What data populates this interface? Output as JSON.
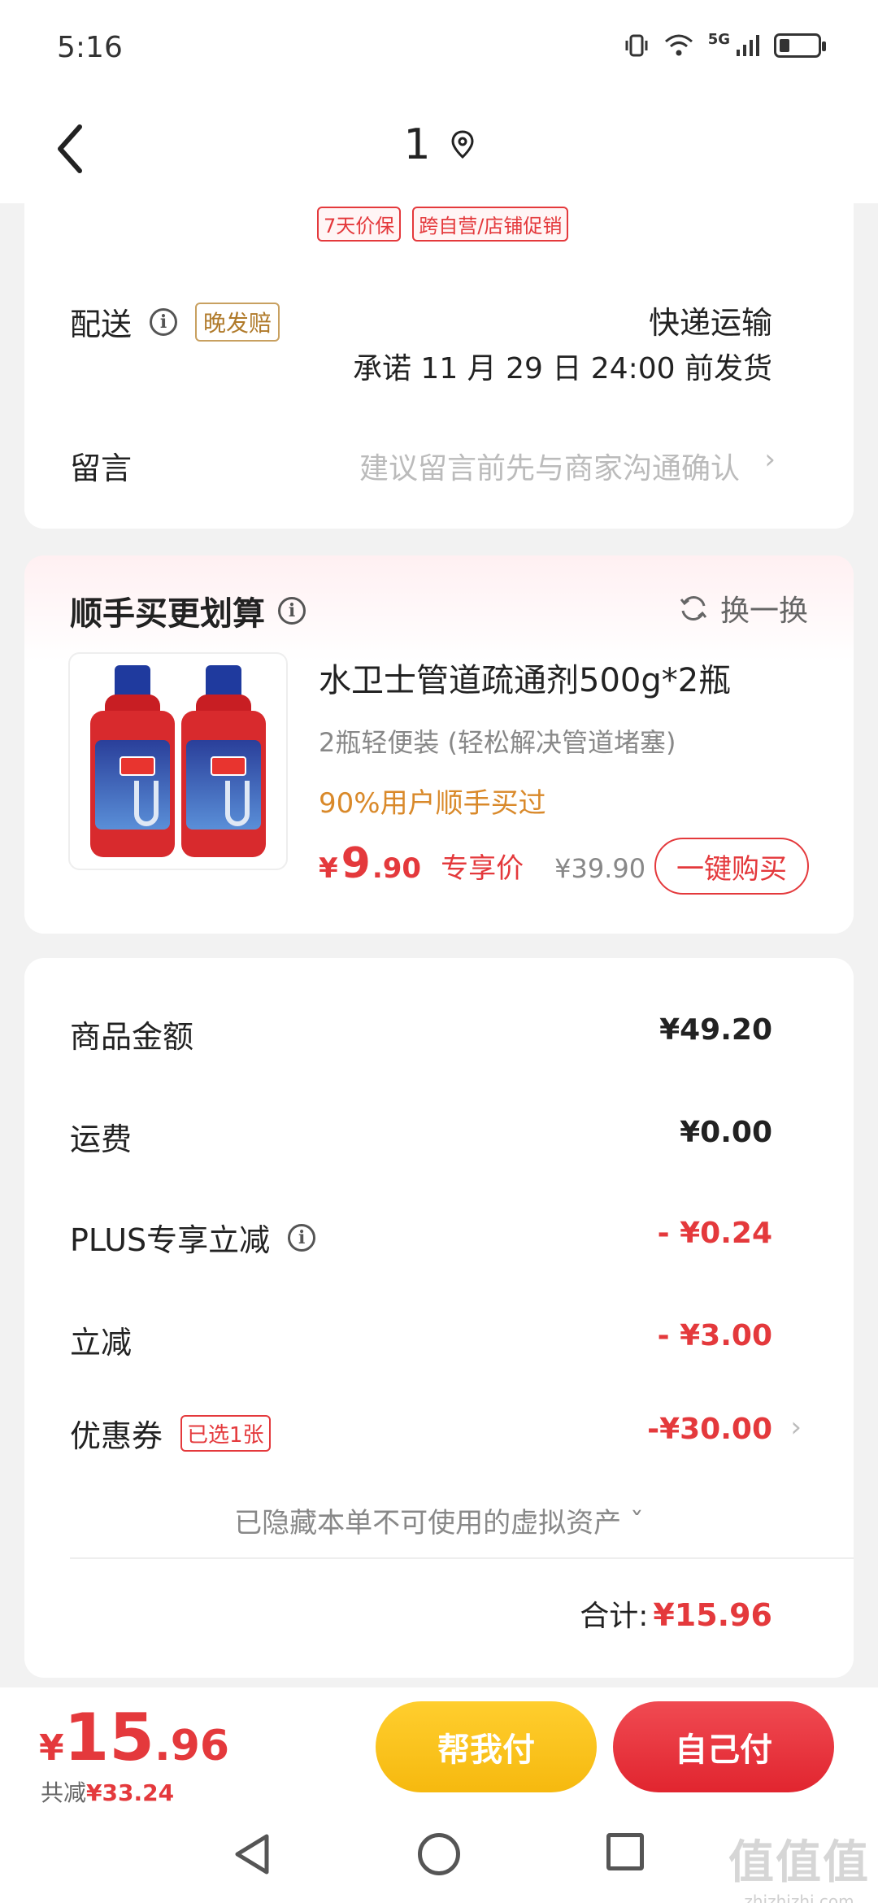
{
  "status_bar": {
    "time": "5:16",
    "network": "5G"
  },
  "nav": {
    "title": "1"
  },
  "order_tags": [
    "7天价保",
    "跨自营/店铺促销"
  ],
  "delivery": {
    "label": "配送",
    "late_tag": "晚发赔",
    "method": "快递运输",
    "promise": "承诺 11 月 29 日 24:00 前发货"
  },
  "message": {
    "label": "留言",
    "placeholder": "建议留言前先与商家沟通确认"
  },
  "bundle": {
    "title": "顺手买更划算",
    "refresh_label": "换一换",
    "product": {
      "name": "水卫士管道疏通剂500g*2瓶",
      "subtitle": "2瓶轻便装 (轻松解决管道堵塞)",
      "popularity": "90%用户顺手买过",
      "price_symbol": "¥",
      "price_int": "9",
      "price_dec": ".90",
      "price_tag": "专享价",
      "original_price": "¥39.90",
      "buy_label": "一键购买"
    }
  },
  "summary": {
    "goods_amount": {
      "label": "商品金额",
      "value": "¥49.20"
    },
    "shipping": {
      "label": "运费",
      "value": "¥0.00"
    },
    "plus_discount": {
      "label": "PLUS专享立减",
      "value": "- ¥0.24"
    },
    "instant_discount": {
      "label": "立减",
      "value": "- ¥3.00"
    },
    "coupon": {
      "label": "优惠券",
      "chip": "已选1张",
      "value": "-¥30.00"
    },
    "hidden_assets": "已隐藏本单不可使用的虚拟资产 ˇ",
    "total_label": "合计:",
    "total_value": "¥15.96"
  },
  "bottom_bar": {
    "price_symbol": "¥",
    "price_int": "15",
    "price_dec": ".96",
    "saved_label": "共减",
    "saved_value": "¥33.24",
    "help_pay_label": "帮我付",
    "self_pay_label": "自己付"
  },
  "watermark": {
    "main": "值值值",
    "sub": "zhizhizhi.com"
  },
  "colors": {
    "accent_red": "#e4393c",
    "gold": "#d9892a",
    "help_pay_yellow": "#ffce2e",
    "self_pay_red": "#e1252f"
  }
}
